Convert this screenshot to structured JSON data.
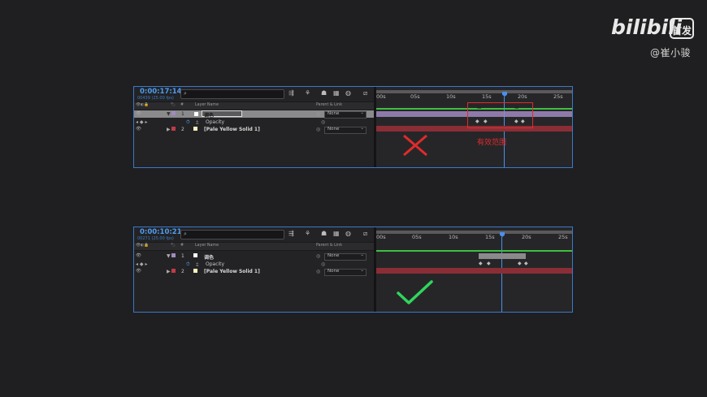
{
  "watermark": {
    "brand": "bilibili",
    "tag": "首发",
    "uploader": "@崔小骏"
  },
  "colors": {
    "timecode": "#4f9cf0",
    "selected_layer_bar": "#a08ac0",
    "solid_bar": "#8a2e36",
    "red_layer_label": "#c13b45",
    "annotation_red": "#e02b2b",
    "check_green": "#2fd65c"
  },
  "columns": {
    "visibility": "👁◐🔒",
    "tag": "🏷",
    "num": "#",
    "layer_name": "Layer Name",
    "parent": "Parent & Link"
  },
  "ruler": [
    "00s",
    "05s",
    "10s",
    "15s",
    "20s",
    "25s"
  ],
  "panel1": {
    "timecode": "0:00:17:14",
    "fps": "00439 (25.00 fps)",
    "layers": [
      {
        "num": "1",
        "name": "调色",
        "parent": "None"
      },
      {
        "prop": "Opacity"
      },
      {
        "num": "2",
        "name": "[Pale Yellow Solid 1]",
        "parent": "None"
      }
    ],
    "annotation": "有效范围"
  },
  "panel2": {
    "timecode": "0:00:10:21",
    "fps": "00271 (25.00 fps)",
    "layers": [
      {
        "num": "1",
        "name": "调色",
        "parent": "None"
      },
      {
        "prop": "Opacity"
      },
      {
        "num": "2",
        "name": "[Pale Yellow Solid 1]",
        "parent": "None"
      }
    ]
  }
}
